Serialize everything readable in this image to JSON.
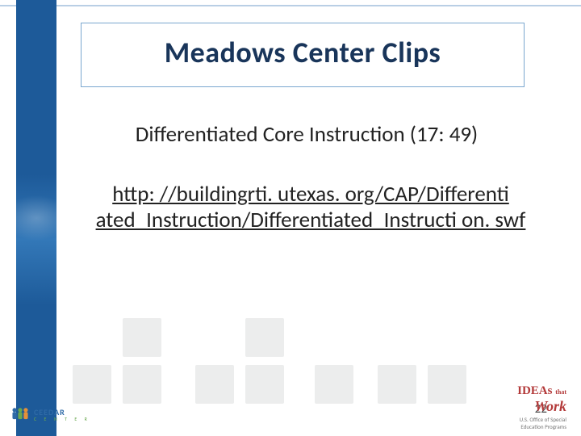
{
  "title": "Meadows Center Clips",
  "subtitle": "Differentiated Core Instruction (17: 49)",
  "link_text": "http: //buildingrti. utexas. org/CAP/Differenti ated_Instruction/Differentiated_Instructi on. swf",
  "page_number": "22",
  "footer": {
    "left_logo_text": "CEEDAR",
    "left_logo_sub": "C E N T E R",
    "right_logo_main": "IDEAs",
    "right_logo_that": "that",
    "right_logo_work": "Work",
    "right_office_line1": "U.S. Office of Special",
    "right_office_line2": "Education Programs"
  }
}
